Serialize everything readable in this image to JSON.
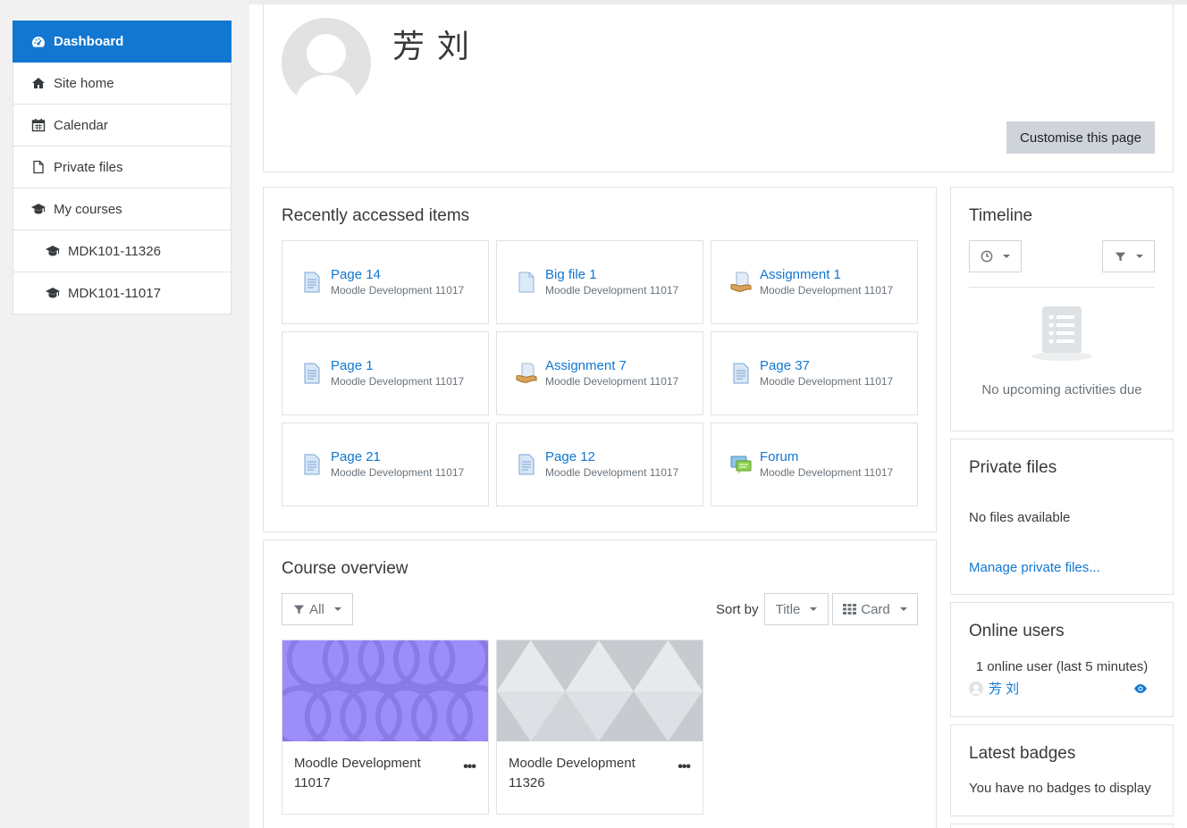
{
  "nav": {
    "items": [
      {
        "label": "Dashboard",
        "icon": "dashboard-icon",
        "active": true
      },
      {
        "label": "Site home",
        "icon": "home-icon"
      },
      {
        "label": "Calendar",
        "icon": "calendar-icon"
      },
      {
        "label": "Private files",
        "icon": "file-icon"
      },
      {
        "label": "My courses",
        "icon": "graduation-cap-icon"
      },
      {
        "label": "MDK101-11326",
        "icon": "graduation-cap-icon"
      },
      {
        "label": "MDK101-11017",
        "icon": "graduation-cap-icon"
      }
    ]
  },
  "header": {
    "user_name": "芳 刘",
    "customise_label": "Customise this page"
  },
  "recent": {
    "title": "Recently accessed items",
    "items": [
      {
        "name": "Page 14",
        "course": "Moodle Development 11017",
        "icon": "page-icon"
      },
      {
        "name": "Big file 1",
        "course": "Moodle Development 11017",
        "icon": "file-icon"
      },
      {
        "name": "Assignment 1",
        "course": "Moodle Development 11017",
        "icon": "assignment-icon"
      },
      {
        "name": "Page 1",
        "course": "Moodle Development 11017",
        "icon": "page-icon"
      },
      {
        "name": "Assignment 7",
        "course": "Moodle Development 11017",
        "icon": "assignment-icon"
      },
      {
        "name": "Page 37",
        "course": "Moodle Development 11017",
        "icon": "page-icon"
      },
      {
        "name": "Page 21",
        "course": "Moodle Development 11017",
        "icon": "page-icon"
      },
      {
        "name": "Page 12",
        "course": "Moodle Development 11017",
        "icon": "page-icon"
      },
      {
        "name": "Forum",
        "course": "Moodle Development 11017",
        "icon": "forum-icon"
      }
    ]
  },
  "overview": {
    "title": "Course overview",
    "filter_label": "All",
    "sort_by_label": "Sort by",
    "sort_value": "Title",
    "view_value": "Card",
    "courses": [
      {
        "line1": "Moodle Development",
        "line2": "11017",
        "menu": "•••"
      },
      {
        "line1": "Moodle Development",
        "line2": "11326",
        "menu": "•••"
      }
    ]
  },
  "timeline": {
    "title": "Timeline",
    "empty_text": "No upcoming activities due"
  },
  "private_files": {
    "title": "Private files",
    "empty_text": "No files available",
    "manage_link": "Manage private files..."
  },
  "online_users": {
    "title": "Online users",
    "summary": "1 online user (last 5 minutes)",
    "user_name": "芳 刘"
  },
  "badges": {
    "title": "Latest badges",
    "empty_text": "You have no badges to display"
  },
  "colors": {
    "primary": "#1177d1",
    "sidebar_bg": "#f1f1f1",
    "border": "#dee2e6"
  }
}
